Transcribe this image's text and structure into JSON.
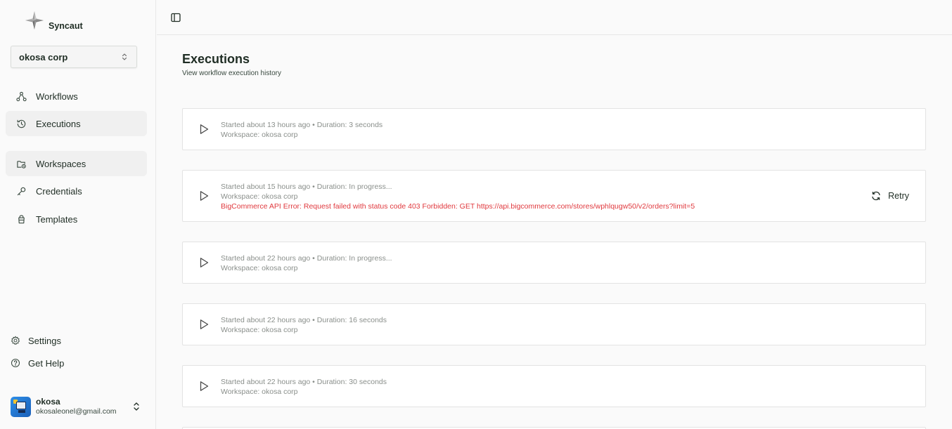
{
  "app": {
    "name": "Syncaut"
  },
  "org": {
    "selected": "okosa corp"
  },
  "nav": {
    "items": [
      {
        "label": "Workflows",
        "icon": "workflow-icon"
      },
      {
        "label": "Executions",
        "icon": "history-icon",
        "active": true
      },
      {
        "label": "Workspaces",
        "icon": "workspace-icon",
        "active": true
      },
      {
        "label": "Credentials",
        "icon": "key-icon"
      },
      {
        "label": "Templates",
        "icon": "template-icon"
      }
    ],
    "bottom": [
      {
        "label": "Settings",
        "icon": "gear-icon"
      },
      {
        "label": "Get Help",
        "icon": "help-icon"
      }
    ]
  },
  "user": {
    "name": "okosa",
    "email": "okosaleonel@gmail.com"
  },
  "page": {
    "title": "Executions",
    "subtitle": "View workflow execution history"
  },
  "executions": [
    {
      "meta": "Started about 13 hours ago • Duration: 3 seconds",
      "workspace": "Workspace: okosa corp"
    },
    {
      "meta": "Started about 15 hours ago • Duration: In progress...",
      "workspace": "Workspace: okosa corp",
      "error": "BigCommerce API Error: Request failed with status code 403 Forbidden: GET https://api.bigcommerce.com/stores/wphlqugw50/v2/orders?limit=5",
      "retry_label": "Retry"
    },
    {
      "meta": "Started about 22 hours ago • Duration: In progress...",
      "workspace": "Workspace: okosa corp"
    },
    {
      "meta": "Started about 22 hours ago • Duration: 16 seconds",
      "workspace": "Workspace: okosa corp"
    },
    {
      "meta": "Started about 22 hours ago • Duration: 30 seconds",
      "workspace": "Workspace: okosa corp"
    }
  ],
  "colors": {
    "text": "#1f2d24",
    "muted": "#8a8f8b",
    "error": "#e0393e",
    "active_bg": "#f0f0f0"
  }
}
